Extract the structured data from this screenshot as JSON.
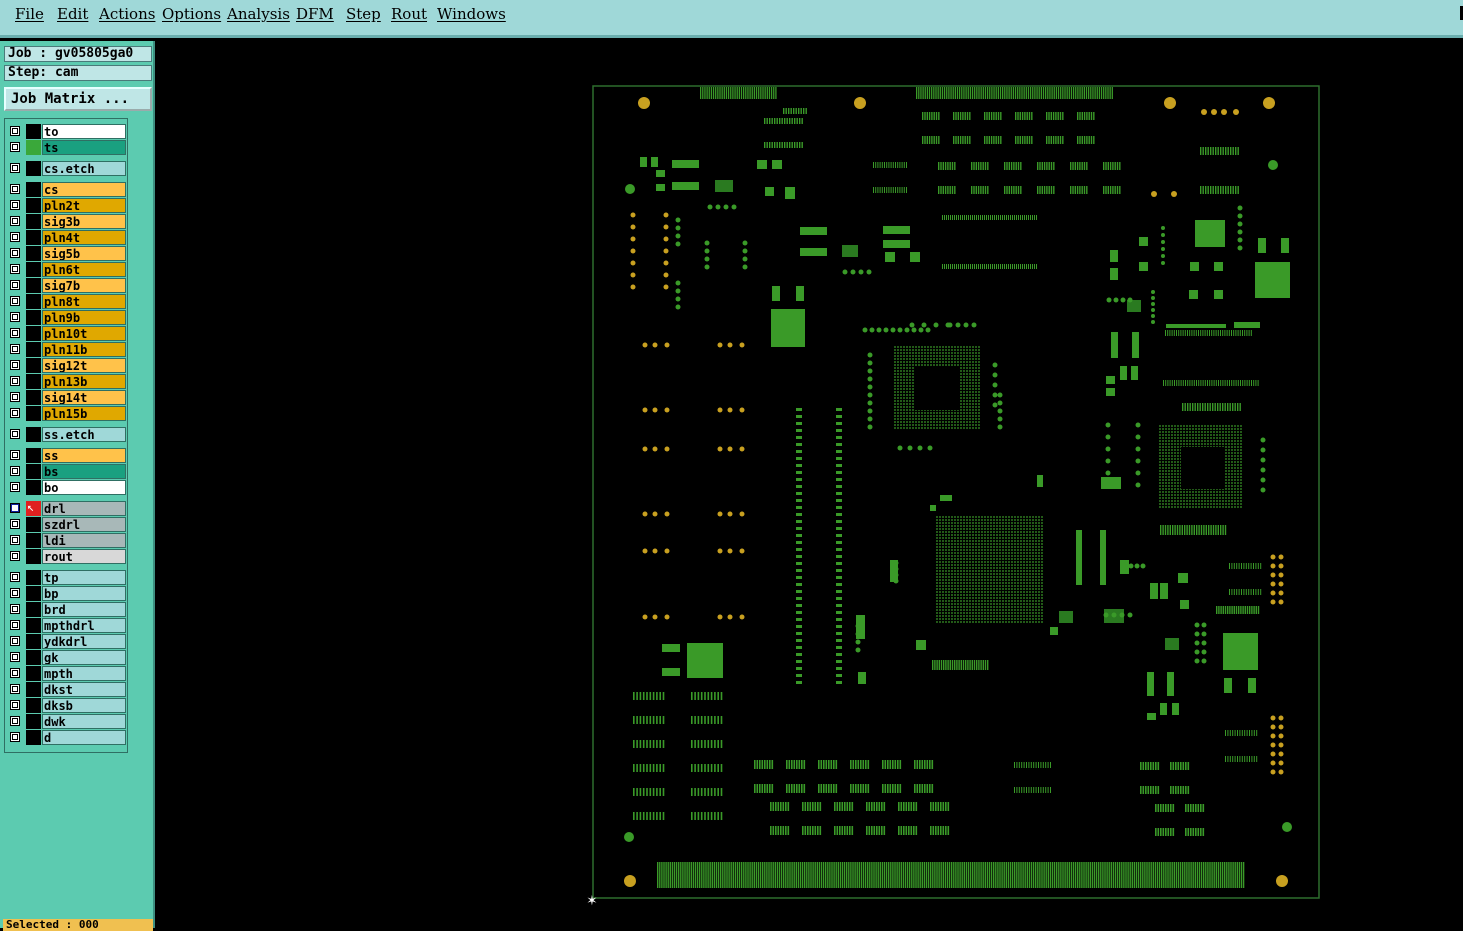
{
  "menu": {
    "items": [
      "File",
      "Edit",
      "Actions",
      "Options",
      "Analysis",
      "DFM",
      "Step",
      "Rout",
      "Windows"
    ]
  },
  "panel": {
    "job": "Job : gv05805ga0",
    "step": "Step: cam",
    "job_matrix_label": "Job Matrix ...",
    "selected": "Selected : 000"
  },
  "layers": [
    {
      "name": "to",
      "color": "#ffffff",
      "swatch": "#000000"
    },
    {
      "name": "ts",
      "color": "#1aa080",
      "swatch": "#3aa83a"
    },
    {
      "name": "cs.etch",
      "color": "#9fd8d8",
      "swatch": "#000000"
    },
    {
      "name": "cs",
      "color": "#ffc24a",
      "swatch": "#000000"
    },
    {
      "name": "pln2t",
      "color": "#e0a800",
      "swatch": "#000000"
    },
    {
      "name": "sig3b",
      "color": "#ffc24a",
      "swatch": "#000000"
    },
    {
      "name": "pln4t",
      "color": "#e0a800",
      "swatch": "#000000"
    },
    {
      "name": "sig5b",
      "color": "#ffc24a",
      "swatch": "#000000"
    },
    {
      "name": "pln6t",
      "color": "#e0a800",
      "swatch": "#000000"
    },
    {
      "name": "sig7b",
      "color": "#ffc24a",
      "swatch": "#000000"
    },
    {
      "name": "pln8t",
      "color": "#e0a800",
      "swatch": "#000000"
    },
    {
      "name": "pln9b",
      "color": "#e0a800",
      "swatch": "#000000"
    },
    {
      "name": "pln10t",
      "color": "#e0a800",
      "swatch": "#000000"
    },
    {
      "name": "pln11b",
      "color": "#e0a800",
      "swatch": "#000000"
    },
    {
      "name": "sig12t",
      "color": "#ffc24a",
      "swatch": "#000000"
    },
    {
      "name": "pln13b",
      "color": "#e0a800",
      "swatch": "#000000"
    },
    {
      "name": "sig14t",
      "color": "#ffc24a",
      "swatch": "#000000"
    },
    {
      "name": "pln15b",
      "color": "#e0a800",
      "swatch": "#000000"
    },
    {
      "name": "ss.etch",
      "color": "#9fd8d8",
      "swatch": "#000000"
    },
    {
      "name": "ss",
      "color": "#ffc24a",
      "swatch": "#000000"
    },
    {
      "name": "bs",
      "color": "#1aa080",
      "swatch": "#000000"
    },
    {
      "name": "bo",
      "color": "#ffffff",
      "swatch": "#000000"
    },
    {
      "name": "drl",
      "color": "#a8b8b8",
      "swatch": "#e02020",
      "active": true
    },
    {
      "name": "szdrl",
      "color": "#a8b8b8",
      "swatch": "#000000"
    },
    {
      "name": "ldi",
      "color": "#a8b8b8",
      "swatch": "#000000"
    },
    {
      "name": "rout",
      "color": "#d8d8d8",
      "swatch": "#000000"
    },
    {
      "name": "tp",
      "color": "#9fd8d8",
      "swatch": "#000000"
    },
    {
      "name": "bp",
      "color": "#9fd8d8",
      "swatch": "#000000"
    },
    {
      "name": "brd",
      "color": "#9fd8d8",
      "swatch": "#000000"
    },
    {
      "name": "mpthdrl",
      "color": "#9fd8d8",
      "swatch": "#000000"
    },
    {
      "name": "ydkdrl",
      "color": "#9fd8d8",
      "swatch": "#000000"
    },
    {
      "name": "gk",
      "color": "#9fd8d8",
      "swatch": "#000000"
    },
    {
      "name": "mpth",
      "color": "#9fd8d8",
      "swatch": "#000000"
    },
    {
      "name": "dkst",
      "color": "#9fd8d8",
      "swatch": "#000000"
    },
    {
      "name": "dksb",
      "color": "#9fd8d8",
      "swatch": "#000000"
    },
    {
      "name": "dwk",
      "color": "#9fd8d8",
      "swatch": "#000000"
    },
    {
      "name": "d",
      "color": "#9fd8d8",
      "swatch": "#000000"
    }
  ],
  "board": {
    "copper_color": "#3a9a28",
    "hole_color": "#c8a020",
    "outline_color": "#2e6e2e",
    "cursor_icon": "crosshair-icon"
  }
}
